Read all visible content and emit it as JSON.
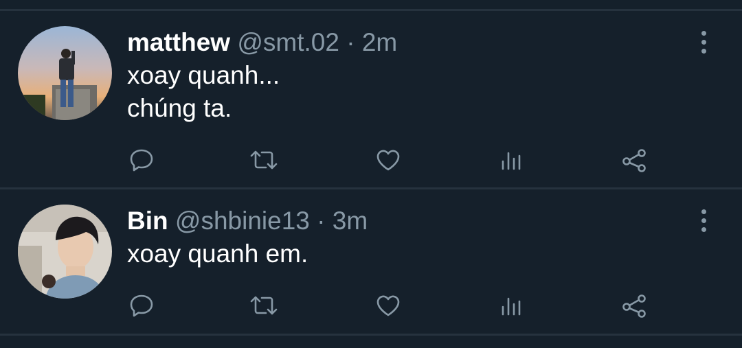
{
  "colors": {
    "background": "#15202b",
    "divider": "#26323e",
    "primary_text": "#ffffff",
    "secondary_text": "#8899a6"
  },
  "tweets": [
    {
      "name": "matthew",
      "handle": "@smt.02",
      "separator": "·",
      "time": "2m",
      "lines": [
        "xoay quanh...",
        "chúng ta."
      ],
      "avatar_icon": "avatar-photo",
      "actions": [
        "reply-icon",
        "retweet-icon",
        "like-icon",
        "views-icon",
        "share-icon"
      ]
    },
    {
      "name": "Bin",
      "handle": "@shbinie13",
      "separator": "·",
      "time": "3m",
      "lines": [
        "xoay quanh em."
      ],
      "avatar_icon": "avatar-photo",
      "actions": [
        "reply-icon",
        "retweet-icon",
        "like-icon",
        "views-icon",
        "share-icon"
      ]
    }
  ]
}
